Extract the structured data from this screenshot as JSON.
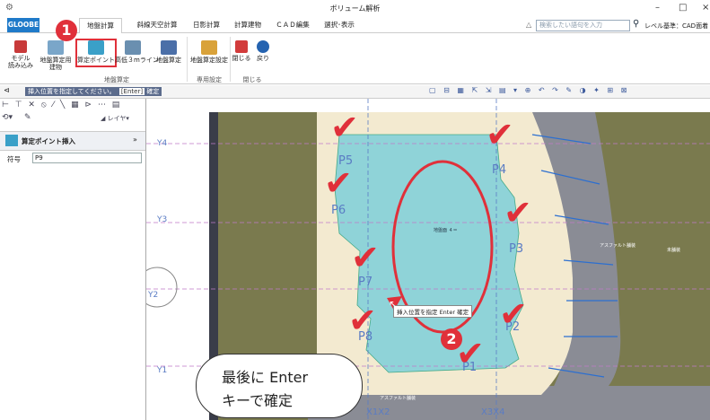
{
  "window": {
    "title": "ボリューム解析",
    "controls": [
      "–",
      "□",
      "×"
    ]
  },
  "tabs": [
    {
      "label": "GLOOBE"
    },
    {
      "label": "地盤計算"
    },
    {
      "label": "斜線天空計算"
    },
    {
      "label": "日影計算"
    },
    {
      "label": "計算建物"
    },
    {
      "label": "ＣＡＤ編集"
    },
    {
      "label": "選択･表示"
    }
  ],
  "search": {
    "placeholder": "検索したい語句を入力"
  },
  "level_label": "レベル基準：CAD面着",
  "ribbon": {
    "buttons": [
      {
        "label": "モデル\n読み込み"
      },
      {
        "label": "地盤算定用\n建物"
      },
      {
        "label": "算定ポイント"
      },
      {
        "label": "高低３mライン"
      },
      {
        "label": "地盤算定"
      },
      {
        "label": "地盤算定設定"
      },
      {
        "label": "閉じる"
      },
      {
        "label": "戻り"
      }
    ],
    "groups": [
      {
        "label": "地盤算定"
      },
      {
        "label": "専用設定"
      },
      {
        "label": "閉じる"
      }
    ]
  },
  "command": {
    "prompt": "挿入位置を指定してください。",
    "enter_key": "[Enter]",
    "confirm": "確定"
  },
  "panel": {
    "layer_label": "レイヤ",
    "title": "算定ポイント挿入",
    "field_label": "符号",
    "field_value": "P9"
  },
  "drawing": {
    "grid_labels_y": [
      "Y4",
      "Y3",
      "Y2",
      "Y1"
    ],
    "grid_labels_x": [
      "X1X2",
      "X3X4"
    ],
    "points": [
      "P5",
      "P4",
      "P6",
      "P3",
      "P7",
      "P8",
      "P2",
      "P1"
    ],
    "tooltip": "挿入位置を指定  Enter  確定",
    "center_label": "地盤面 ４＝",
    "road_label": "アスファルト舗装",
    "yard_label": "未舗装",
    "road_label_bottom": "アスファルト舗装"
  },
  "callout": {
    "line1": "最後に Enter",
    "line2": "キーで確定"
  },
  "markers": [
    {
      "number": "1"
    },
    {
      "number": "2"
    }
  ],
  "colors": {
    "accent": "#1f7ac9",
    "highlight": "#e0303a",
    "site": "#f3ead0",
    "slab": "#8fd3d8",
    "terrain": "#7a7a4e",
    "road": "#8a8c95"
  }
}
